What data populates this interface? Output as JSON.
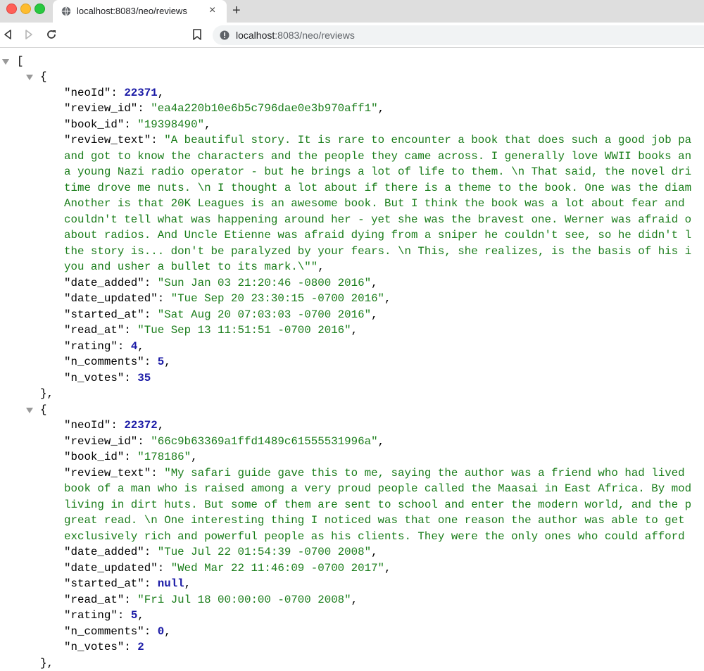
{
  "browser": {
    "tab_title": "localhost:8083/neo/reviews",
    "url_host": "localhost",
    "url_rest": ":8083/neo/reviews",
    "close_glyph": "×",
    "newtab_glyph": "+"
  },
  "json": {
    "open_bracket": "[",
    "records": [
      {
        "neoId": "22371",
        "review_id": "\"ea4a220b10e6b5c796dae0e3b970aff1\"",
        "book_id": "\"19398490\"",
        "review_text_lines": [
          "\"A beautiful story. It is rare to encounter a book that does such a good job pa",
          "and got to know the characters and the people they came across. I generally love WWII books an",
          "a young Nazi radio operator - but he brings a lot of life to them. \\n That said, the novel dri",
          "time drove me nuts. \\n I thought a lot about if there is a theme to the book. One was the diam",
          "Another is that 20K Leagues is an awesome book. But I think the book was a lot about fear and",
          "couldn't tell what was happening around her - yet she was the bravest one. Werner was afraid o",
          "about radios. And Uncle Etienne was afraid dying from a sniper he couldn't see, so he didn't l",
          "the story is... don't be paralyzed by your fears. \\n This, she realizes, is the basis of his i",
          "you and usher a bullet to its mark.\\\"\""
        ],
        "date_added": "\"Sun Jan 03 21:20:46 -0800 2016\"",
        "date_updated": "\"Tue Sep 20 23:30:15 -0700 2016\"",
        "started_at": "\"Sat Aug 20 07:03:03 -0700 2016\"",
        "read_at": "\"Tue Sep 13 11:51:51 -0700 2016\"",
        "rating": "4",
        "n_comments": "5",
        "n_votes": "35"
      },
      {
        "neoId": "22372",
        "review_id": "\"66c9b63369a1ffd1489c61555531996a\"",
        "book_id": "\"178186\"",
        "review_text_lines": [
          "\"My safari guide gave this to me, saying the author was a friend who had lived",
          "book of a man who is raised among a very proud people called the Maasai in East Africa. By mod",
          "living in dirt huts. But some of them are sent to school and enter the modern world, and the p",
          "great read. \\n One interesting thing I noticed was that one reason the author was able to get",
          "exclusively rich and powerful people as his clients. They were the only ones who could afford"
        ],
        "date_added": "\"Tue Jul 22 01:54:39 -0700 2008\"",
        "date_updated": "\"Wed Mar 22 11:46:09 -0700 2017\"",
        "started_at": "null",
        "read_at": "\"Fri Jul 18 00:00:00 -0700 2008\"",
        "rating": "5",
        "n_comments": "0",
        "n_votes": "2"
      }
    ]
  },
  "colors": {
    "string": "#1a7d1a",
    "number": "#1a1aa6",
    "key": "#000000"
  }
}
